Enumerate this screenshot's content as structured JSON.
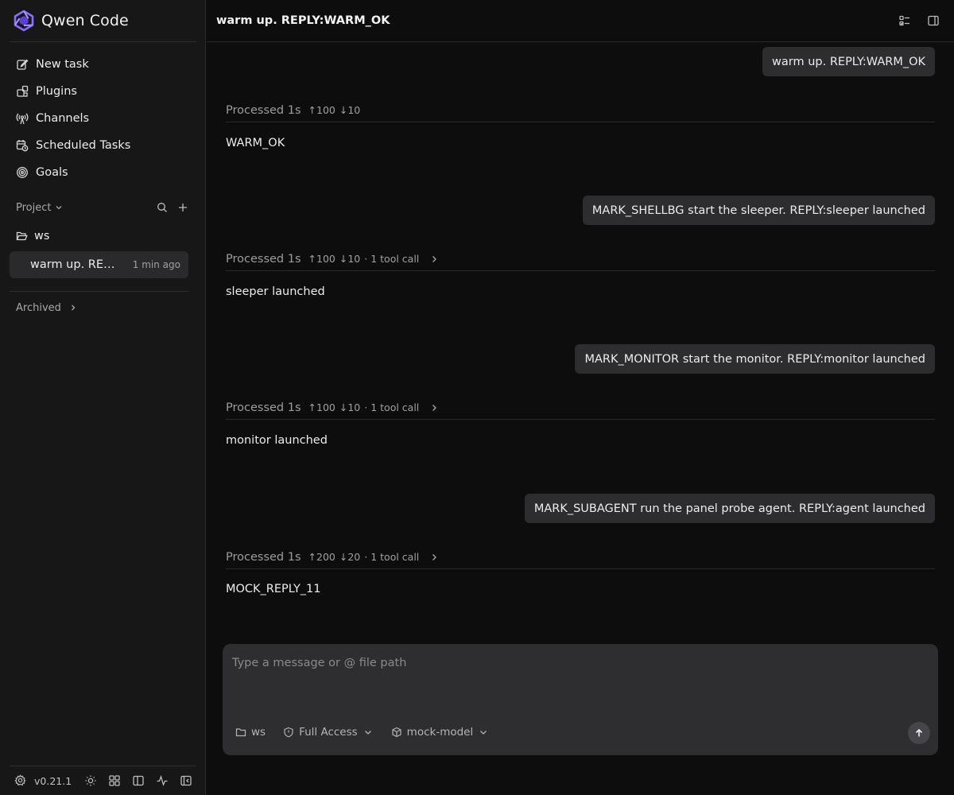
{
  "app": {
    "name": "Qwen Code",
    "logo_icon": "qwen-logo-icon",
    "accent": "#7c5cff"
  },
  "sidebar": {
    "nav": [
      {
        "label": "New task",
        "icon": "edit-icon"
      },
      {
        "label": "Plugins",
        "icon": "puzzle-icon"
      },
      {
        "label": "Channels",
        "icon": "broadcast-icon"
      },
      {
        "label": "Scheduled Tasks",
        "icon": "calendar-clock-icon"
      },
      {
        "label": "Goals",
        "icon": "target-icon"
      }
    ],
    "project_label": "Project",
    "folder": "ws",
    "task": {
      "title": "warm up. REPLY:WARM_OK",
      "time": "1 min ago"
    },
    "archived_label": "Archived",
    "version": "v0.21.1"
  },
  "header": {
    "title": "warm up. REPLY:WARM_OK"
  },
  "conversation": [
    {
      "user": "warm up. REPLY:WARM_OK",
      "processed": "Processed 1s",
      "up": "↑100",
      "down": "↓10",
      "tool": "",
      "reply": "WARM_OK"
    },
    {
      "user": "MARK_SHELLBG start the sleeper. REPLY:sleeper launched",
      "processed": "Processed 1s",
      "up": "↑100",
      "down": "↓10",
      "tool": "· 1 tool call",
      "reply": "sleeper launched"
    },
    {
      "user": "MARK_MONITOR start the monitor. REPLY:monitor launched",
      "processed": "Processed 1s",
      "up": "↑100",
      "down": "↓10",
      "tool": "· 1 tool call",
      "reply": "monitor launched"
    },
    {
      "user": "MARK_SUBAGENT run the panel probe agent. REPLY:agent launched",
      "processed": "Processed 1s",
      "up": "↑200",
      "down": "↓20",
      "tool": "· 1 tool call",
      "reply": "MOCK_REPLY_11"
    }
  ],
  "composer": {
    "placeholder": "Type a message or @ file path",
    "folder": "ws",
    "access": "Full Access",
    "model": "mock-model"
  }
}
